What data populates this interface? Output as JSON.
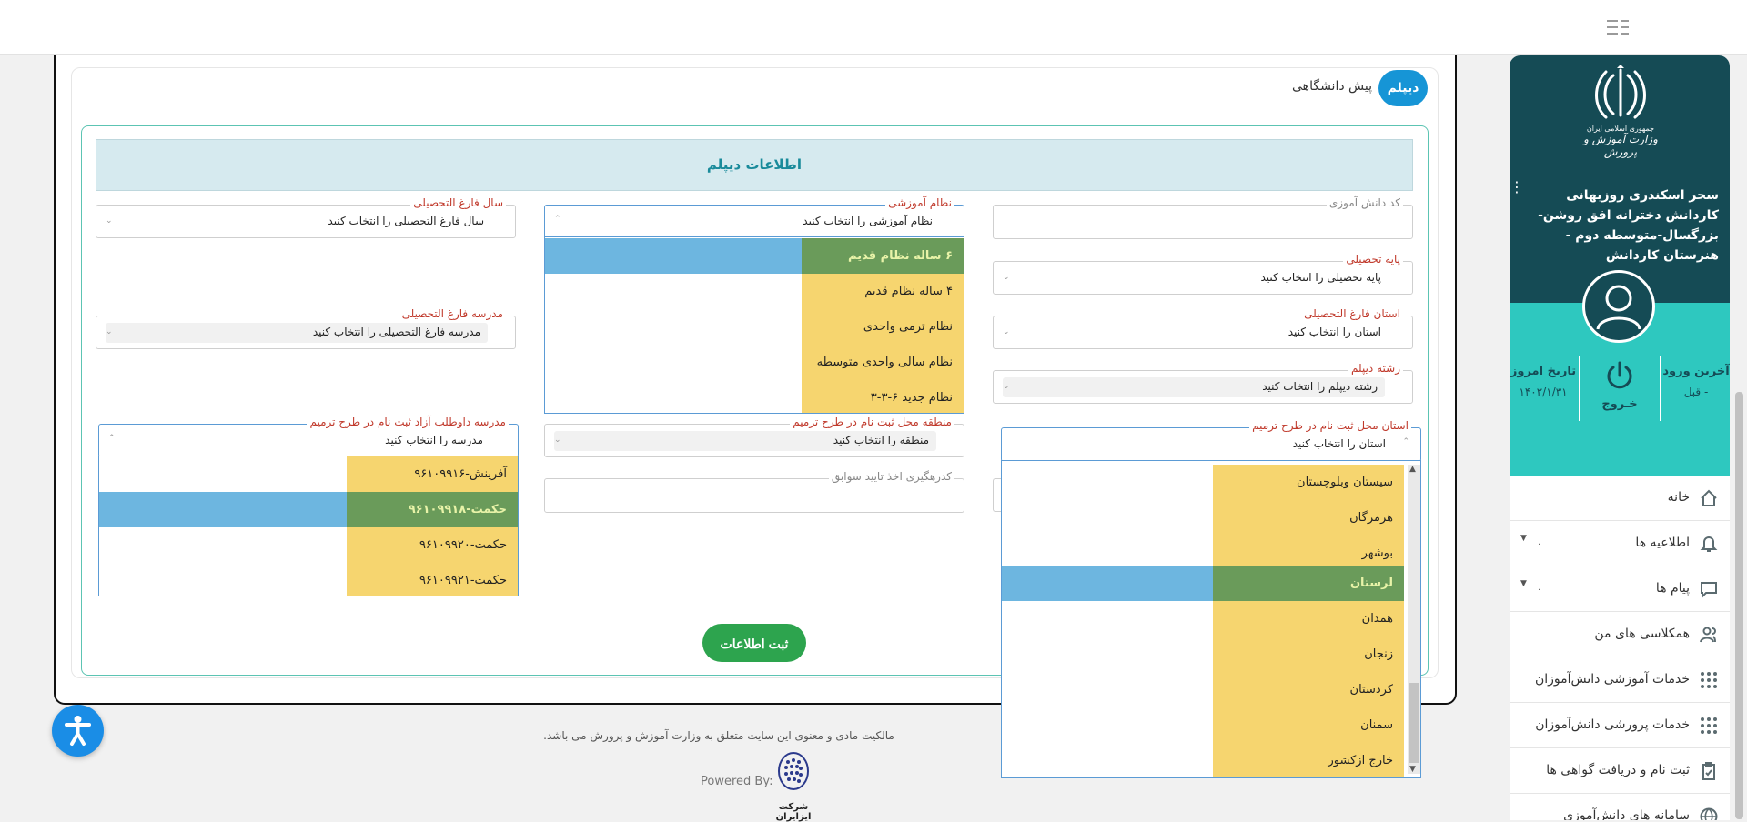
{
  "sidebar": {
    "emblem_line1": "جمهوری اسلامی ایران",
    "emblem_line2": "وزارت آموزش و پرورش",
    "user_name": "سحر اسکندری روزبهانی کاردانش دخترانه افق روشن- بزرگسال-متوسطه دوم - هنرستان کاردانش",
    "last_login_label": "آخرین ورود",
    "last_login_value": "- قبل",
    "logout_label": "خـروج",
    "today_label": "تاریخ امروز",
    "today_value": "۱۴۰۲/۱/۳۱",
    "menu": [
      {
        "label": "خانه",
        "icon": "home-icon"
      },
      {
        "label": "اطلاعیه ها",
        "icon": "bell-icon",
        "badge": "۰"
      },
      {
        "label": "پیام ها",
        "icon": "message-icon",
        "badge": "۰"
      },
      {
        "label": "همکلاسی های من",
        "icon": "classmates-icon"
      },
      {
        "label": "خدمات آموزشی دانش‌آموزان",
        "icon": "grid-icon"
      },
      {
        "label": "خدمات پرورشی دانش‌آموزان",
        "icon": "grid-icon"
      },
      {
        "label": "ثبت نام و دریافت گواهی ها",
        "icon": "clipboard-icon"
      },
      {
        "label": "سامانه های دانش‌آموزی",
        "icon": "globe-icon"
      }
    ]
  },
  "tabs": {
    "active": "دیپلم",
    "other": "پیش دانشگاهی"
  },
  "section_title": "اطلاعات دیپلم",
  "fields": {
    "student_code": {
      "label": "کد دانش آموزی",
      "value": ""
    },
    "education_system": {
      "label": "نظام آموزشی",
      "value": "نظام آموزشی را انتخاب کنید"
    },
    "graduation_year": {
      "label": "سال فارغ التحصیلی",
      "value": "سال فارغ التحصیلی را انتخاب کنید"
    },
    "grade_base": {
      "label": "پایه تحصیلی",
      "value": "پایه تحصیلی را انتخاب کنید"
    },
    "graduation_province": {
      "label": "استان فارغ التحصیلی",
      "value": "استان را انتخاب کنید"
    },
    "graduation_school": {
      "label": "مدرسه فارغ التحصیلی",
      "value": "مدرسه فارغ التحصیلی را انتخاب کنید"
    },
    "diploma_field": {
      "label": "رشته دیپلم",
      "value": "رشته دیپلم را انتخاب کنید"
    },
    "reg_province": {
      "label": "استان محل ثبت نام در طرح ترمیم",
      "value": "استان را انتخاب کنید"
    },
    "reg_region": {
      "label": "منطقه محل ثبت نام در طرح ترمیم",
      "value": "منطقه را انتخاب کنید"
    },
    "free_school": {
      "label": "مدرسه داوطلب آزاد ثبت نام در طرح ترمیم",
      "value": "مدرسه را انتخاب کنید"
    },
    "tracking_code": {
      "label": "کدرهگیری اخذ تایید سوابق",
      "value": ""
    }
  },
  "education_options": [
    "۶ ساله نظام قدیم",
    "۴ ساله نظام قدیم",
    "نظام ترمی واحدی",
    "نظام سالی واحدی متوسطه",
    "نظام جدید ۶-۳-۳"
  ],
  "province_options": [
    "سیستان وبلوچستان",
    "هرمزگان",
    "بوشهر",
    "لرستان",
    "همدان",
    "زنجان",
    "کردستان",
    "سمنان",
    "خارج ازکشور"
  ],
  "school_options": [
    "آفرینش-۹۶۱۰۹۹۱۶",
    "حکمت-۹۶۱۰۹۹۱۸",
    "حکمت-۹۶۱۰۹۹۲۰",
    "حکمت-۹۶۱۰۹۹۲۱"
  ],
  "submit_label": "ثبت اطلاعات",
  "footer": {
    "copyright": "مالکیت مادی و معنوی این سایت متعلق به وزارت آموزش و پرورش می باشد.",
    "powered_by": "Powered By:",
    "company": "شرکت ایزایران"
  },
  "colors": {
    "sidebar_dark": "#154b55",
    "sidebar_teal": "#2ec8bf",
    "tab_active": "#1695d6",
    "submit": "#2da44e",
    "option_highlight": "#f6d56f",
    "option_selected": "#6db6e0"
  }
}
